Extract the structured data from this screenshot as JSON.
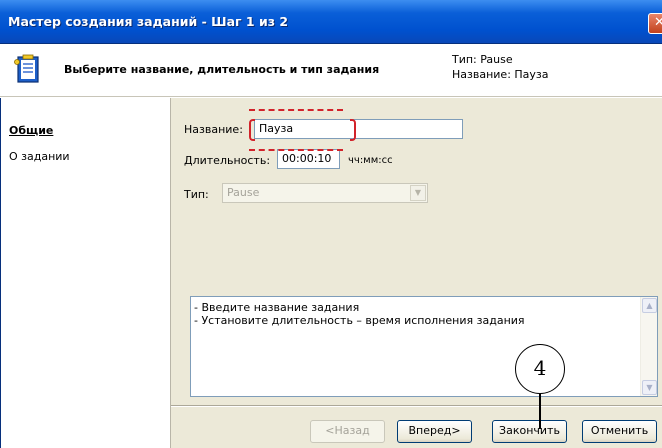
{
  "window": {
    "title": "Мастер создания заданий - Шаг 1 из 2",
    "close_glyph": "✕"
  },
  "header": {
    "subtitle": "Выберите название, длительность и тип задания",
    "type_info": "Тип: Pause",
    "name_info": "Название: Пауза",
    "icon": "wizard-document-icon"
  },
  "sidebar": {
    "items": [
      {
        "label": "Общие",
        "active": true
      },
      {
        "label": "О задании",
        "active": false
      }
    ]
  },
  "form": {
    "name_label": "Название:",
    "name_value": "Пауза",
    "duration_label": "Длительность:",
    "duration_value": "00:00:10",
    "duration_format": "чч:мм:сс",
    "type_label": "Тип:",
    "type_value": "Pause",
    "type_disabled": true
  },
  "hints": {
    "lines": [
      "- Введите название задания",
      "- Установите длительность – время исполнения задания"
    ]
  },
  "buttons": {
    "back": "<Назад",
    "next": "Вперед>",
    "finish": "Закончить",
    "cancel": "Отменить"
  },
  "annotation": {
    "callout_number": "4",
    "highlight_color": "#d2232a"
  }
}
